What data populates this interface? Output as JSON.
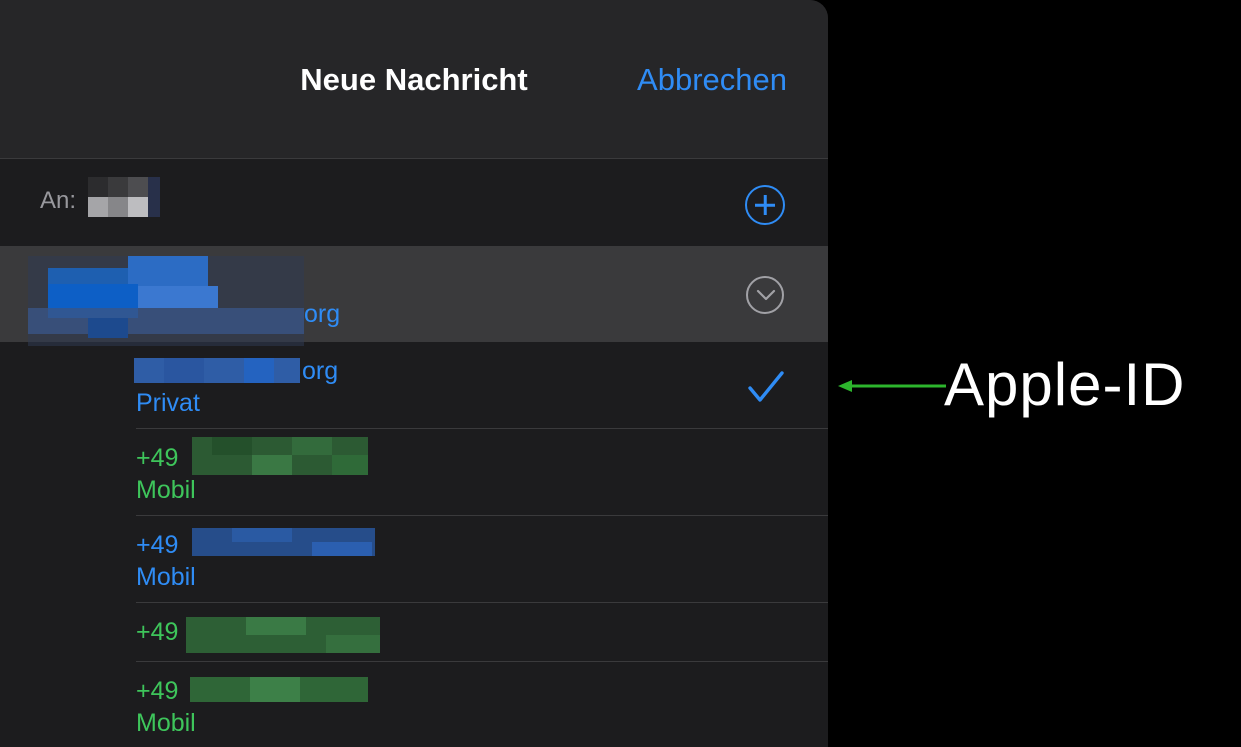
{
  "navbar": {
    "title": "Neue Nachricht",
    "cancel_label": "Abbrechen"
  },
  "to_field": {
    "label": "An:"
  },
  "contact": {
    "email_suffix": "org"
  },
  "addresses": [
    {
      "value": "org",
      "type": "Privat",
      "color": "#2f8cf5",
      "selected": true
    },
    {
      "value": "+49",
      "type": "Mobil",
      "color": "#3ec55b"
    },
    {
      "value": "+49",
      "type": "Mobil",
      "color": "#2f8cf5"
    },
    {
      "value": "+49",
      "type": "",
      "color": "#3ec55b"
    },
    {
      "value": "+49",
      "type": "Mobil",
      "color": "#3ec55b"
    }
  ],
  "annotation": {
    "label": "Apple-ID",
    "arrow_color": "#2db52d"
  },
  "icons": [
    "plus-circle-icon",
    "chevron-down-circle-icon",
    "checkmark-icon",
    "arrow-left-icon"
  ]
}
